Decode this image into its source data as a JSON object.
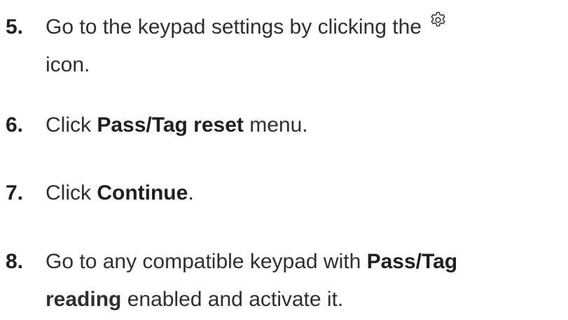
{
  "steps": [
    {
      "number": "5.",
      "text_before": "Go to the keypad settings by clicking the",
      "icon": "gear-icon",
      "continuation": "icon."
    },
    {
      "number": "6.",
      "text_before": "Click ",
      "bold": "Pass/Tag reset",
      "text_after": " menu."
    },
    {
      "number": "7.",
      "text_before": "Click ",
      "bold": "Continue",
      "text_after": "."
    },
    {
      "number": "8.",
      "text_before": "Go to any compatible keypad with ",
      "bold": "Pass/Tag",
      "continuation_bold": "reading",
      "continuation": " enabled and activate it."
    }
  ]
}
